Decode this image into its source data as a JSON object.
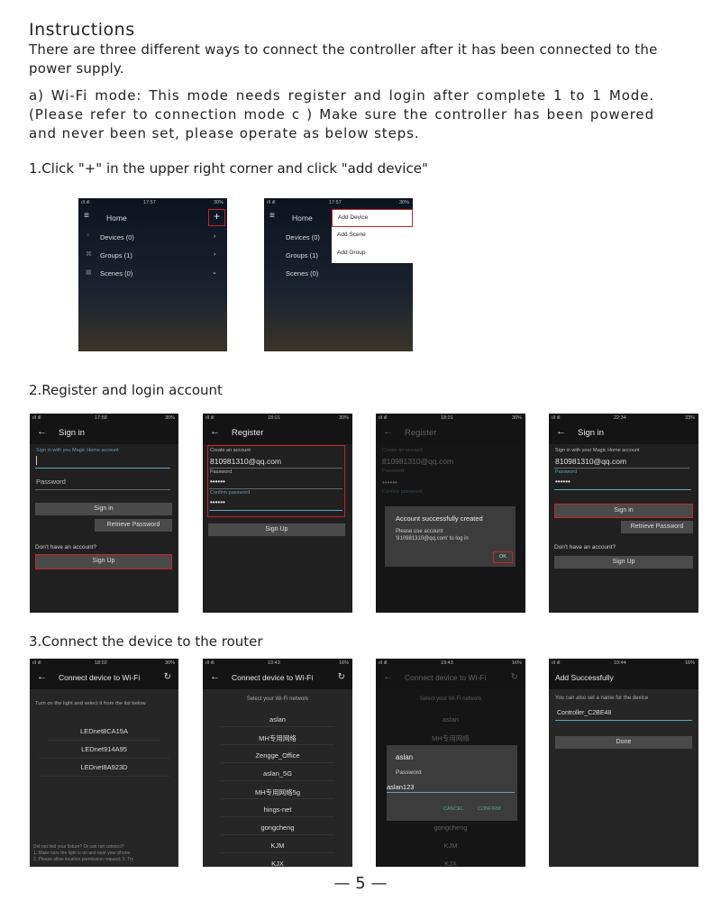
{
  "heading": "Instructions",
  "intro": "There are three different ways to connect the controller after it has been connected to the power supply.",
  "mode_a": "a) Wi-Fi mode: This mode needs register and login after complete 1 to 1 Mode.(Please refer to connection mode c ) Make sure the controller has been powered and never been set, please operate as below steps.",
  "step1": {
    "label": "1.Click \"+\" in the upper right corner and click \"add device\"",
    "home": {
      "time": "17:57",
      "title": "Home",
      "plus": "+",
      "items": [
        "Devices (0)",
        "Groups (1)",
        "Scenes (0)"
      ]
    },
    "menu": [
      "Add Device",
      "Add Scene",
      "Add Group"
    ]
  },
  "step2": {
    "label": "2.Register and login account",
    "signin": {
      "time": "17:58",
      "title": "Sign in",
      "hint": "Sign in with you Magic Home account",
      "password": "Password",
      "signin_btn": "Sign in",
      "retrieve": "Retrieve Password",
      "no_account": "Don't have an account?",
      "signup_btn": "Sign Up"
    },
    "register": {
      "time": "18:01",
      "title": "Register",
      "create": "Create an account",
      "email": "810981310@qq.com",
      "password": "Password",
      "dots": "••••••",
      "confirm": "Confirm password",
      "signup_btn": "Sign Up"
    },
    "dialog": {
      "time": "18:01",
      "title": "Account successfully created",
      "msg1": "Please use account",
      "msg2": "'810981310@qq.com' to log in",
      "ok": "OK"
    },
    "signin2": {
      "time": "22:34",
      "hint": "Sign in with your Magic Home account",
      "email": "810981310@qq.com",
      "password": "Password"
    }
  },
  "step3": {
    "label": "3.Connect the device to the router",
    "connect": {
      "time": "18:02",
      "title": "Connect device to Wi-Fi",
      "instr": "Turn on the light and select it from the list below",
      "devices": [
        "LEDnet8CA15A",
        "LEDnet914A95",
        "LEDnet8A923D"
      ],
      "help1": "Did not find your fixture? Or can not connect?",
      "help2": "1. Make sure the light is on and near your phone.",
      "help3": "2. Please allow location permission request; 3. Try"
    },
    "wifi": {
      "time": "19:43",
      "select": "Select your Wi-Fi network",
      "networks": [
        "aslan",
        "MH专用网络",
        "Zengge_Office",
        "aslan_5G",
        "MH专用网络5g",
        "hings-net",
        "gongcheng",
        "KJM",
        "KJX"
      ]
    },
    "pwd": {
      "time": "19:43",
      "ssid": "aslan",
      "password_label": "Password",
      "password": "aslan123",
      "cancel": "CANCEL",
      "confirm": "CONFIRM"
    },
    "done": {
      "time": "19:44",
      "title": "Add Successfully",
      "hint": "You can also set a name for the device",
      "name": "Controller_C2BE48",
      "done_btn": "Done"
    }
  },
  "page_number": "— 5 —",
  "colors": {
    "highlight": "#c8232c",
    "accent": "#5fa3c0"
  }
}
